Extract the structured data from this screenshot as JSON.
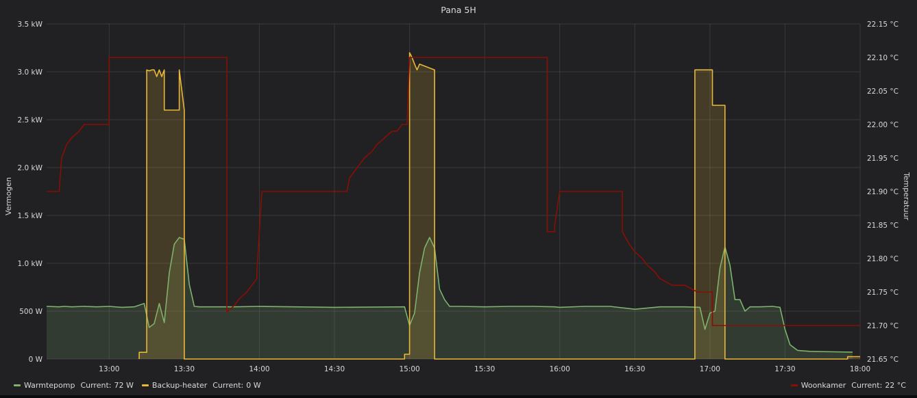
{
  "panel": {
    "title": "Pana 5H"
  },
  "chart_data": {
    "type": "line",
    "title": "Pana 5H",
    "x_ticks": [
      "13:00",
      "13:30",
      "14:00",
      "14:30",
      "15:00",
      "15:30",
      "16:00",
      "16:30",
      "17:00",
      "17:30",
      "18:00"
    ],
    "xlim": [
      "12:35",
      "18:00"
    ],
    "left_axis": {
      "label": "Vermogen",
      "unit": "W",
      "ylim": [
        0,
        3500
      ],
      "ticks": [
        "0 W",
        "500 W",
        "1.0 kW",
        "1.5 kW",
        "2.0 kW",
        "2.5 kW",
        "3.0 kW",
        "3.5 kW"
      ]
    },
    "right_axis": {
      "label": "Temperatuur",
      "unit": "°C",
      "ylim": [
        21.65,
        22.15
      ],
      "ticks": [
        "21.65 °C",
        "21.70 °C",
        "21.75 °C",
        "21.80 °C",
        "21.85 °C",
        "21.90 °C",
        "21.95 °C",
        "22.00 °C",
        "22.05 °C",
        "22.10 °C",
        "22.15 °C"
      ]
    },
    "grid": true,
    "legend_position": "bottom",
    "series": [
      {
        "name": "Warmtepomp",
        "axis": "left",
        "color": "#7eb26d",
        "fill": true,
        "current_label": "Current:",
        "current_value": "72 W",
        "x": [
          "12:35",
          "12:40",
          "12:42",
          "12:45",
          "12:50",
          "12:55",
          "13:00",
          "13:05",
          "13:10",
          "13:14",
          "13:16",
          "13:18",
          "13:20",
          "13:22",
          "13:24",
          "13:26",
          "13:28",
          "13:30",
          "13:32",
          "13:34",
          "13:36",
          "13:40",
          "13:50",
          "14:00",
          "14:30",
          "14:58",
          "15:00",
          "15:02",
          "15:04",
          "15:06",
          "15:08",
          "15:10",
          "15:12",
          "15:14",
          "15:16",
          "15:20",
          "15:30",
          "15:40",
          "15:50",
          "15:58",
          "16:00",
          "16:10",
          "16:20",
          "16:30",
          "16:40",
          "16:50",
          "16:56",
          "16:58",
          "17:00",
          "17:02",
          "17:04",
          "17:06",
          "17:08",
          "17:10",
          "17:12",
          "17:14",
          "17:16",
          "17:20",
          "17:25",
          "17:28",
          "17:30",
          "17:32",
          "17:35",
          "17:40",
          "17:50",
          "17:57"
        ],
        "values": [
          550,
          545,
          550,
          545,
          550,
          545,
          550,
          540,
          545,
          580,
          330,
          370,
          580,
          380,
          900,
          1200,
          1270,
          1250,
          780,
          550,
          545,
          545,
          545,
          550,
          540,
          545,
          350,
          480,
          900,
          1160,
          1270,
          1160,
          730,
          620,
          550,
          550,
          545,
          550,
          550,
          545,
          540,
          550,
          550,
          520,
          545,
          545,
          540,
          310,
          480,
          500,
          950,
          1170,
          980,
          620,
          620,
          500,
          545,
          545,
          550,
          540,
          310,
          150,
          90,
          80,
          75,
          72
        ]
      },
      {
        "name": "Backup-heater",
        "axis": "left",
        "color": "#eab839",
        "fill": true,
        "current_label": "Current:",
        "current_value": "0 W",
        "x": [
          "13:12",
          "13:12",
          "13:15",
          "13:15",
          "13:16",
          "13:17",
          "13:18",
          "13:19",
          "13:20",
          "13:21",
          "13:22",
          "13:22",
          "13:28",
          "13:28",
          "13:30",
          "13:30",
          "14:58",
          "14:58",
          "15:00",
          "15:00",
          "15:01",
          "15:02",
          "15:03",
          "15:04",
          "15:10",
          "15:10",
          "16:54",
          "16:54",
          "17:01",
          "17:01",
          "17:06",
          "17:06",
          "17:55",
          "17:55",
          "18:00"
        ],
        "values": [
          0,
          70,
          70,
          3020,
          3010,
          3020,
          3020,
          2950,
          3020,
          2950,
          3020,
          2600,
          2600,
          3020,
          2600,
          0,
          0,
          50,
          50,
          3200,
          3150,
          3080,
          3020,
          3080,
          3020,
          0,
          0,
          3020,
          3020,
          2650,
          2650,
          0,
          0,
          25,
          25
        ]
      },
      {
        "name": "Woonkamer",
        "axis": "right",
        "color": "#890f02",
        "fill": false,
        "current_label": "Current:",
        "current_value": "22 °C",
        "x": [
          "12:35",
          "12:40",
          "12:40",
          "12:41",
          "12:42",
          "12:43",
          "12:45",
          "12:45",
          "12:48",
          "12:48",
          "12:50",
          "12:50",
          "12:53",
          "12:53",
          "12:56",
          "12:56",
          "13:00",
          "13:00",
          "13:02",
          "13:47",
          "13:47",
          "13:50",
          "13:52",
          "13:55",
          "13:57",
          "13:59",
          "13:59",
          "14:01",
          "14:35",
          "14:36",
          "14:38",
          "14:40",
          "14:42",
          "14:45",
          "14:47",
          "14:50",
          "14:53",
          "14:55",
          "14:57",
          "14:59",
          "15:00",
          "15:01",
          "15:02",
          "15:55",
          "15:55",
          "15:58",
          "15:58",
          "16:00",
          "16:25",
          "16:25",
          "16:28",
          "16:30",
          "16:33",
          "16:35",
          "16:38",
          "16:40",
          "16:45",
          "16:48",
          "16:50",
          "16:55",
          "17:01",
          "17:01",
          "17:02",
          "18:00"
        ],
        "values": [
          21.9,
          21.9,
          21.9,
          21.95,
          21.96,
          21.97,
          21.98,
          21.98,
          21.99,
          21.99,
          22.0,
          22.0,
          22.0,
          22.0,
          22.0,
          22.0,
          22.0,
          22.1,
          22.1,
          22.1,
          21.72,
          21.73,
          21.74,
          21.75,
          21.76,
          21.77,
          21.78,
          21.9,
          21.9,
          21.92,
          21.93,
          21.94,
          21.95,
          21.96,
          21.97,
          21.98,
          21.99,
          21.99,
          22.0,
          22.0,
          22.1,
          22.1,
          22.1,
          22.1,
          21.84,
          21.84,
          21.85,
          21.9,
          21.9,
          21.84,
          21.82,
          21.81,
          21.8,
          21.79,
          21.78,
          21.77,
          21.76,
          21.76,
          21.76,
          21.75,
          21.75,
          21.7,
          21.7,
          21.7
        ]
      }
    ]
  }
}
